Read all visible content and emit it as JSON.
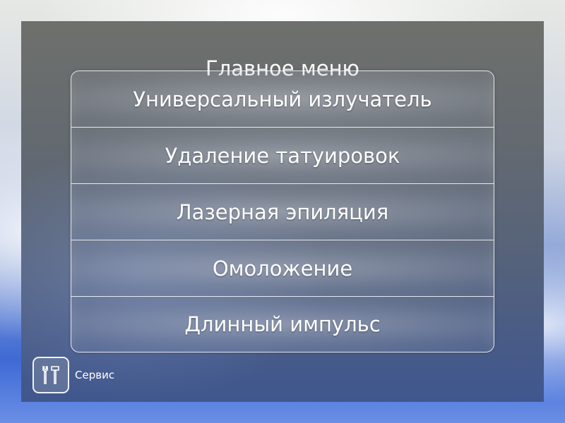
{
  "main_menu": {
    "title": "Главное меню",
    "items": [
      {
        "label": "Универсальный излучатель"
      },
      {
        "label": "Удаление татуировок"
      },
      {
        "label": "Лазерная эпиляция"
      },
      {
        "label": "Омоложение"
      },
      {
        "label": "Длинный импульс"
      }
    ]
  },
  "service": {
    "label": "Сервис",
    "icon": "tools-icon"
  },
  "colors": {
    "panel_top": "#6e706c",
    "panel_bottom": "#3f578f",
    "text": "#ffffff"
  }
}
